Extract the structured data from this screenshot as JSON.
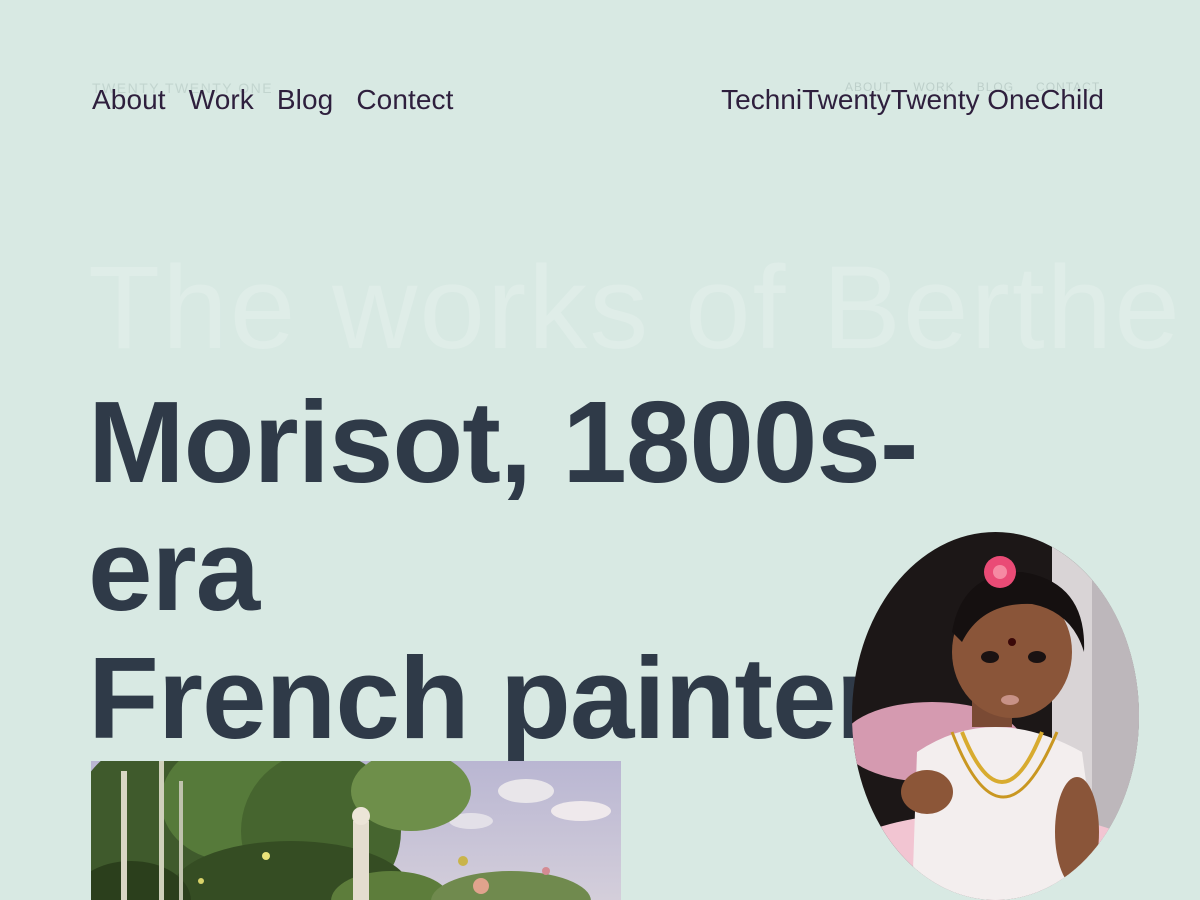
{
  "ghost_nav": {
    "left_text": "Twenty Twenty One",
    "right_items": [
      "About",
      "Work",
      "Blog",
      "Contact"
    ]
  },
  "nav": {
    "items": [
      "About",
      "Work",
      "Blog",
      "Contect"
    ]
  },
  "brand": "TechniTwentyTwenty OneChild",
  "ghost_heading": "The works of Berthe",
  "headline": {
    "line1": "Morisot, 1800s-era",
    "line2": "French painter"
  },
  "images": {
    "painting": "impressionist-garden-painting",
    "avatar": "child-portrait-photo"
  },
  "colors": {
    "background": "#d8e9e3",
    "nav_text": "#2e1f3d",
    "headline_text": "#2f3a48"
  }
}
